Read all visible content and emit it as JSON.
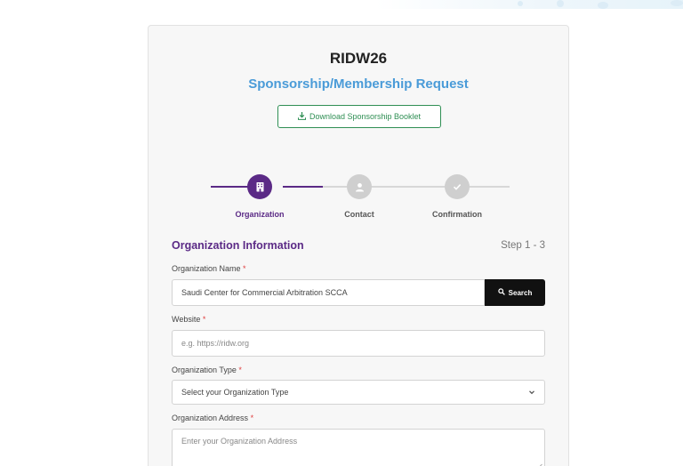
{
  "header": {
    "title": "RIDW26",
    "subtitle": "Sponsorship/Membership Request",
    "download_label": "Download Sponsorship Booklet"
  },
  "stepper": {
    "steps": [
      {
        "label": "Organization",
        "state": "active",
        "icon": "building-icon"
      },
      {
        "label": "Contact",
        "state": "inactive",
        "icon": "user-icon"
      },
      {
        "label": "Confirmation",
        "state": "inactive",
        "icon": "check-icon"
      }
    ]
  },
  "section": {
    "title": "Organization Information",
    "step_count": "Step 1 - 3"
  },
  "form": {
    "org_name": {
      "label": "Organization Name",
      "value": "Saudi Center for Commercial Arbitration SCCA",
      "search_label": "Search"
    },
    "website": {
      "label": "Website",
      "placeholder": "e.g. https://ridw.org"
    },
    "org_type": {
      "label": "Organization Type",
      "selected": "Select your Organization Type"
    },
    "org_address": {
      "label": "Organization Address",
      "placeholder": "Enter your Organization Address"
    }
  },
  "colors": {
    "accent_purple": "#5b2a86",
    "subtitle_blue": "#4a9bd8",
    "download_green": "#2f8f54",
    "inactive_gray": "#cfcfcf"
  }
}
